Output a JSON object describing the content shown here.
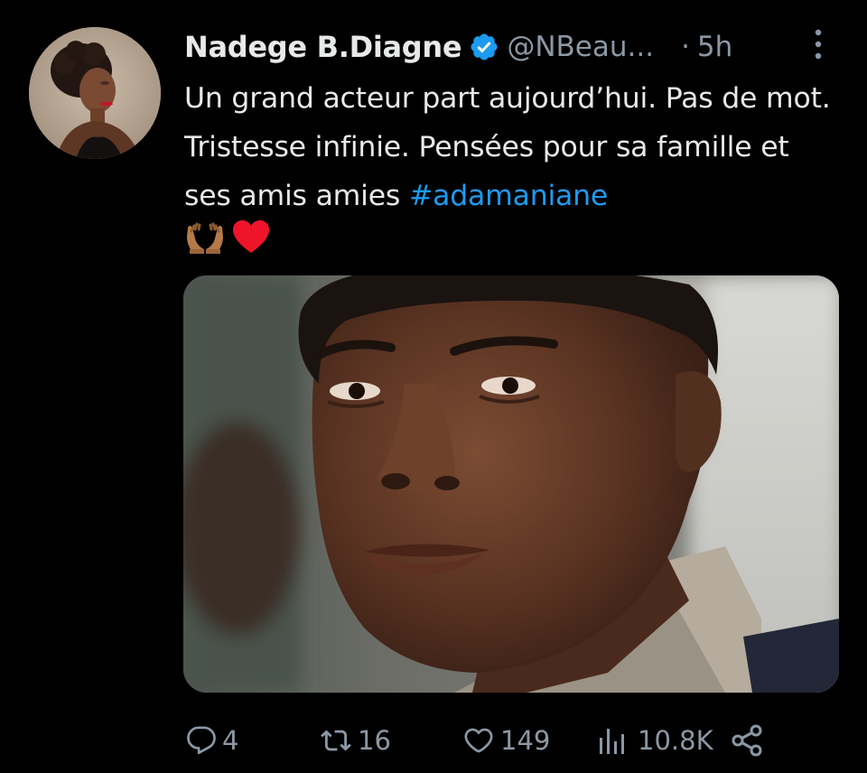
{
  "tweet": {
    "author": {
      "display_name": "Nadege B.Diagne",
      "handle": "@NBeau...",
      "verified": true,
      "avatar_icon": "profile-photo"
    },
    "separator": "·",
    "time": "5h",
    "text_before_hashtag": "Un grand acteur part aujourd’hui. Pas de mot. Tristesse infinie. Pensées pour sa famille et ses amis amies ",
    "hashtag": "#adamaniane",
    "emojis": [
      "palms-up-together-icon",
      "red-heart-icon"
    ],
    "media": {
      "kind": "photo",
      "subject": "portrait-of-man"
    },
    "actions": {
      "replies": "4",
      "retweets": "16",
      "likes": "149",
      "views": "10.8K"
    }
  },
  "colors": {
    "background": "#000000",
    "text": "#e7e9ea",
    "muted": "#8b98a5",
    "link": "#1d9bf0",
    "verified": "#1d9bf0",
    "heart": "#f0142a"
  }
}
